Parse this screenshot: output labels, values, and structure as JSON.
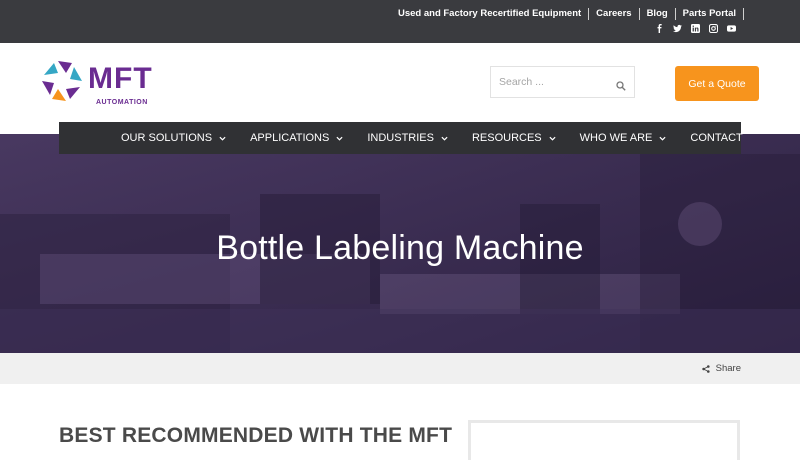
{
  "topbar": {
    "links": [
      "Used and Factory Recertified Equipment",
      "Careers",
      "Blog",
      "Parts Portal"
    ],
    "social_icons": [
      "facebook-icon",
      "twitter-icon",
      "linkedin-icon",
      "instagram-icon",
      "youtube-icon"
    ]
  },
  "header": {
    "logo_text": "MFT",
    "logo_subtext": "AUTOMATION",
    "search_placeholder": "Search ...",
    "quote_button": "Get a Quote"
  },
  "nav": {
    "items": [
      {
        "label": "OUR SOLUTIONS",
        "has_dropdown": true
      },
      {
        "label": "APPLICATIONS",
        "has_dropdown": true
      },
      {
        "label": "INDUSTRIES",
        "has_dropdown": true
      },
      {
        "label": "RESOURCES",
        "has_dropdown": true
      },
      {
        "label": "WHO WE ARE",
        "has_dropdown": true
      },
      {
        "label": "CONTACT",
        "has_dropdown": false
      }
    ]
  },
  "hero": {
    "title": "Bottle Labeling Machine"
  },
  "share": {
    "label": "Share"
  },
  "content": {
    "heading": "BEST RECOMMENDED WITH THE MFT"
  },
  "colors": {
    "topbar_bg": "#3a3b3f",
    "accent_orange": "#f7941d",
    "brand_purple": "#5b2a86",
    "nav_bg": "#303134"
  }
}
